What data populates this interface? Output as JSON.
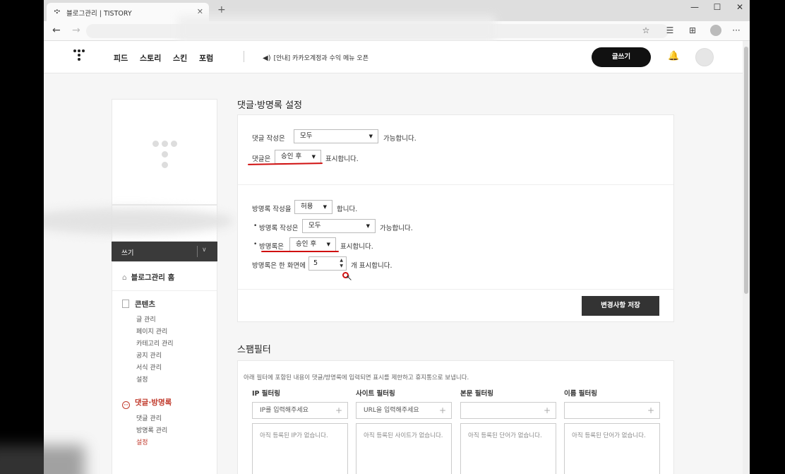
{
  "browser": {
    "tab_title": "블로그관리 | TISTORY",
    "tab_favicon": "tistory-icon",
    "tab_close": "✕",
    "new_tab": "+",
    "controls": {
      "minimize": "—",
      "maximize": "☐",
      "close": "✕"
    }
  },
  "gnb": {
    "nav": [
      "피드",
      "스토리",
      "스킨",
      "포럼"
    ],
    "notice": "[안내] 카카오계정과 수익 메뉴 오픈",
    "write_button": "글쓰기"
  },
  "sidebar": {
    "write": "쓰기",
    "home": "블로그관리 홈",
    "contents_head": "콘텐츠",
    "contents_items": [
      "글 관리",
      "페이지 관리",
      "카테고리 관리",
      "공지 관리",
      "서식 관리",
      "설정"
    ],
    "comments_head": "댓글·방명록",
    "comments_items": [
      "댓글 관리",
      "방명록 관리",
      "설정"
    ]
  },
  "comment_settings": {
    "title": "댓글·방명록 설정",
    "comment_write_prefix": "댓글 작성은",
    "comment_write_value": "모두",
    "comment_write_suffix": "가능합니다.",
    "comment_display_prefix": "댓글은",
    "comment_display_value": "승인 후",
    "comment_display_suffix": "표시합니다.",
    "guestbook_write_prefix": "방명록 작성을",
    "guestbook_write_value": "허용",
    "guestbook_write_suffix": "합니다.",
    "guestbook_who_prefix": "방명록 작성은",
    "guestbook_who_value": "모두",
    "guestbook_who_suffix": "가능합니다.",
    "guestbook_display_prefix": "방명록은",
    "guestbook_display_value": "승인 후",
    "guestbook_display_suffix": "표시합니다.",
    "guestbook_count_prefix": "방명록은 한 화면에",
    "guestbook_count_value": "5",
    "guestbook_count_suffix": "개 표시합니다.",
    "save_button": "변경사항 저장"
  },
  "spam": {
    "title": "스팸필터",
    "description": "아래 필터에 포함된 내용이 댓글/방명록에 입력되면 표시를 제한하고 휴지통으로 보냅니다.",
    "filters": [
      {
        "label": "IP 필터링",
        "placeholder": "IP를 입력해주세요",
        "empty": "아직 등록된 IP가 없습니다."
      },
      {
        "label": "사이트 필터링",
        "placeholder": "URL을 입력해주세요",
        "empty": "아직 등록된 사이트가 없습니다."
      },
      {
        "label": "본문 필터링",
        "placeholder": "",
        "empty": "아직 등록된 단어가 없습니다."
      },
      {
        "label": "이름 필터링",
        "placeholder": "",
        "empty": "아직 등록된 단어가 없습니다."
      }
    ]
  },
  "annotation_color": "#d01010"
}
